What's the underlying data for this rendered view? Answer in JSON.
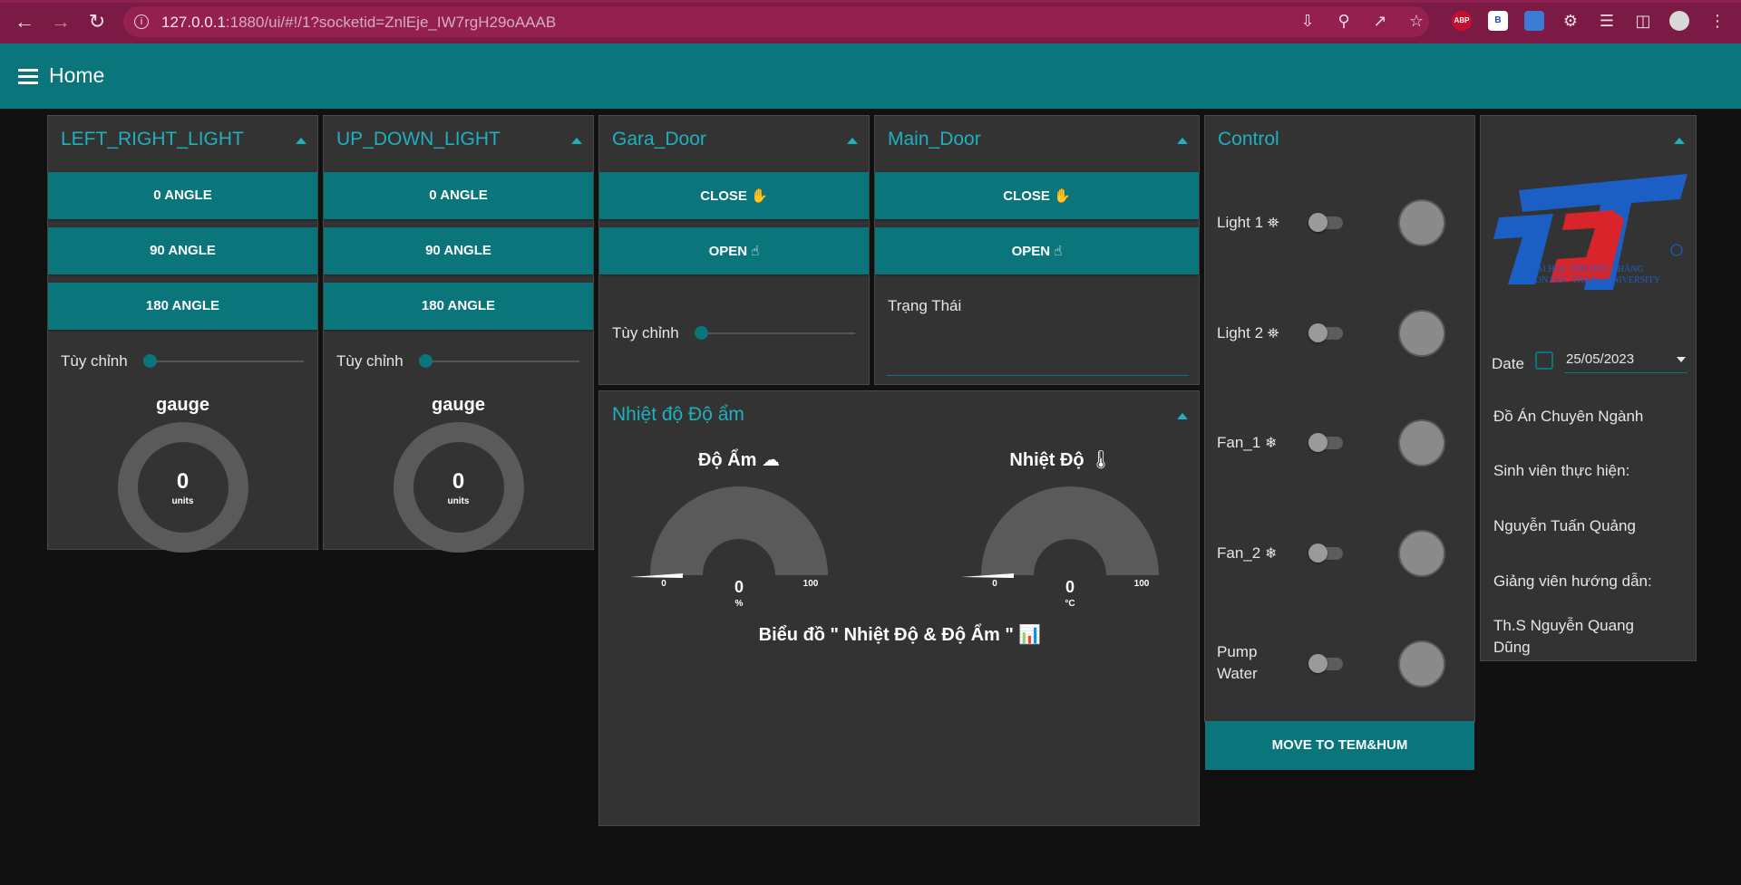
{
  "browser": {
    "url_host": "127.0.0.1",
    "url_rest": ":1880/ui/#!/1?socketid=ZnlEje_IW7rgH29oAAAB",
    "ext_abp": "ABP",
    "ext_b": "B"
  },
  "header": {
    "title": "Home"
  },
  "left_right_light": {
    "title": "LEFT_RIGHT_LIGHT",
    "buttons": [
      "0 ANGLE",
      "90 ANGLE",
      "180 ANGLE"
    ],
    "slider_label": "Tùy chỉnh",
    "slider_value": 0,
    "gauge_title": "gauge",
    "gauge_value": "0",
    "gauge_unit": "units"
  },
  "up_down_light": {
    "title": "UP_DOWN_LIGHT",
    "buttons": [
      "0 ANGLE",
      "90 ANGLE",
      "180 ANGLE"
    ],
    "slider_label": "Tùy chỉnh",
    "slider_value": 0,
    "gauge_title": "gauge",
    "gauge_value": "0",
    "gauge_unit": "units"
  },
  "gara_door": {
    "title": "Gara_Door",
    "close_label": "CLOSE",
    "open_label": "OPEN",
    "slider_label": "Tùy chỉnh",
    "slider_value": 0
  },
  "main_door": {
    "title": "Main_Door",
    "close_label": "CLOSE",
    "open_label": "OPEN",
    "status_label": "Trạng Thái"
  },
  "temp_humidity": {
    "title": "Nhiệt độ Độ ẩm",
    "humidity_title": "Độ Ẩm",
    "humidity_value": "0",
    "humidity_unit": "%",
    "humidity_min": "0",
    "humidity_max": "100",
    "temp_title": "Nhiệt Độ",
    "temp_value": "0",
    "temp_unit": "°C",
    "temp_min": "0",
    "temp_max": "100",
    "chart_title": "Biểu đồ \" Nhiệt Độ & Độ Ẩm \""
  },
  "control": {
    "title": "Control",
    "items": [
      {
        "label": "Light 1",
        "icon": "lightbulb-icon",
        "on": false
      },
      {
        "label": "Light 2",
        "icon": "lightbulb-icon",
        "on": false
      },
      {
        "label": "Fan_1",
        "icon": "snowflake-icon",
        "on": false
      },
      {
        "label": "Fan_2",
        "icon": "snowflake-icon",
        "on": false
      },
      {
        "label1": "Pump",
        "label2": "Water",
        "on": false
      }
    ],
    "move_button": "MOVE TO TEM&HUM"
  },
  "info": {
    "logo_text1": "ĐẠI HỌC TÔN ĐỨC THẮNG",
    "logo_text2": "TON DUC THANG UNIVERSITY",
    "date_label": "Date",
    "date_value": "25/05/2023",
    "project": "Đồ Án Chuyên Ngành",
    "student_label": "Sinh viên thực hiện:",
    "student_name": "Nguyễn Tuấn Quảng",
    "advisor_label": "Giảng viên hướng dẫn:",
    "advisor_name": "Th.S Nguyễn Quang Dũng"
  },
  "colors": {
    "accent": "#0a767c",
    "title_color": "#1eb1bd",
    "card_bg": "#333333",
    "browser_bar": "#7b1a44"
  }
}
